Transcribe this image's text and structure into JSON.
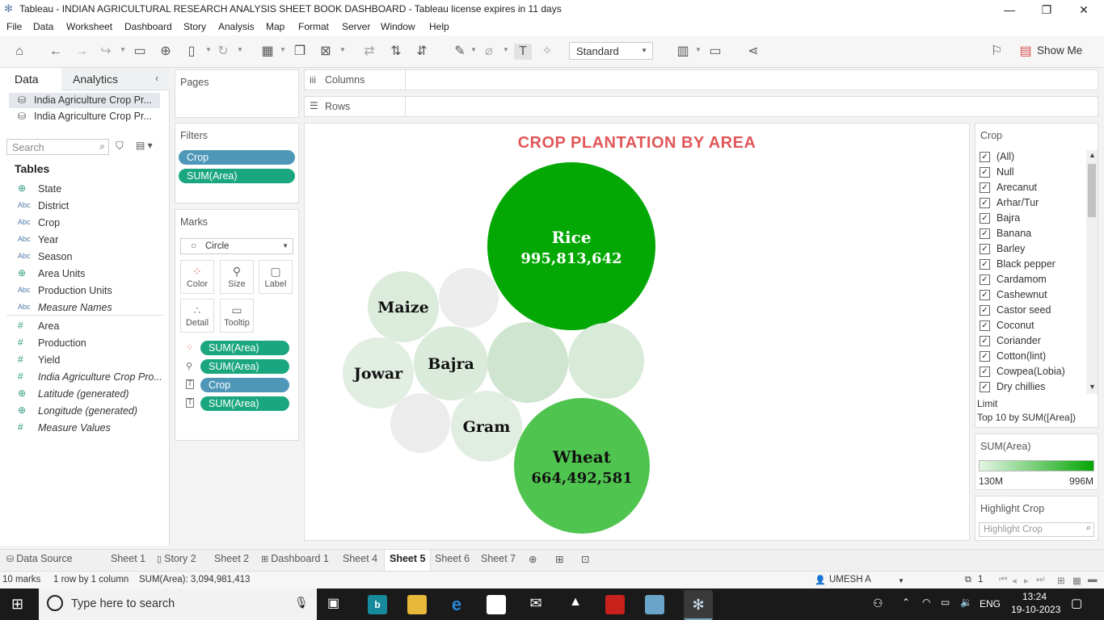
{
  "window": {
    "title": "Tableau - INDIAN AGRICULTURAL RESEARCH ANALYSIS SHEET BOOK DASHBOARD - Tableau license expires in 11 days"
  },
  "menu": [
    "File",
    "Data",
    "Worksheet",
    "Dashboard",
    "Story",
    "Analysis",
    "Map",
    "Format",
    "Server",
    "Window",
    "Help"
  ],
  "toolbar": {
    "fit_mode": "Standard",
    "show_me": "Show Me"
  },
  "left_pane": {
    "tab_data": "Data",
    "tab_analytics": "Analytics",
    "sources": [
      "India Agriculture Crop Pr...",
      "India Agriculture Crop Pr..."
    ],
    "search_placeholder": "Search",
    "tables_label": "Tables",
    "dimensions": [
      {
        "icon": "globe",
        "name": "State"
      },
      {
        "icon": "Abc",
        "name": "District"
      },
      {
        "icon": "Abc",
        "name": "Crop"
      },
      {
        "icon": "Abc",
        "name": "Year"
      },
      {
        "icon": "Abc",
        "name": "Season"
      },
      {
        "icon": "globe",
        "name": "Area Units"
      },
      {
        "icon": "Abc",
        "name": "Production Units"
      },
      {
        "icon": "Abc",
        "name": "Measure Names"
      }
    ],
    "measures": [
      {
        "icon": "#",
        "name": "Area"
      },
      {
        "icon": "#",
        "name": "Production"
      },
      {
        "icon": "#",
        "name": "Yield"
      },
      {
        "icon": "#",
        "name": "India Agriculture Crop Pro..."
      },
      {
        "icon": "globe",
        "name": "Latitude (generated)"
      },
      {
        "icon": "globe",
        "name": "Longitude (generated)"
      },
      {
        "icon": "#",
        "name": "Measure Values"
      }
    ]
  },
  "pages_label": "Pages",
  "filters": {
    "label": "Filters",
    "pills": [
      "Crop",
      "SUM(Area)"
    ]
  },
  "marks": {
    "label": "Marks",
    "type": "Circle",
    "buttons": [
      "Color",
      "Size",
      "Label",
      "Detail",
      "Tooltip"
    ],
    "pills": [
      "SUM(Area)",
      "SUM(Area)",
      "Crop",
      "SUM(Area)"
    ]
  },
  "shelves": {
    "columns": "Columns",
    "rows": "Rows"
  },
  "chart_data": {
    "type": "packed-bubble",
    "title": "CROP PLANTATION BY AREA",
    "measure": "SUM(Area)",
    "bubbles": [
      {
        "label": "Rice",
        "value": 995813642,
        "value_label": "995,813,642",
        "color": "#04a804"
      },
      {
        "label": "Wheat",
        "value": 664492581,
        "value_label": "664,492,581",
        "color": "#4fc44f"
      },
      {
        "label": "Maize",
        "value": null,
        "color": "#dcecdc"
      },
      {
        "label": "Jowar",
        "value": null,
        "color": "#e2eee2"
      },
      {
        "label": "Bajra",
        "value": null,
        "color": "#dbebdb"
      },
      {
        "label": "Gram",
        "value": null,
        "color": "#e2ede2"
      },
      {
        "label": "",
        "value": null,
        "color": "#cfe5cf"
      },
      {
        "label": "",
        "value": null,
        "color": "#d8ead8"
      },
      {
        "label": "",
        "value": null,
        "color": "#ededed"
      },
      {
        "label": "",
        "value": null,
        "color": "#ececec"
      }
    ]
  },
  "crop_filter": {
    "label": "Crop",
    "items": [
      "(All)",
      "Null",
      "Arecanut",
      "Arhar/Tur",
      "Bajra",
      "Banana",
      "Barley",
      "Black pepper",
      "Cardamom",
      "Cashewnut",
      "Castor seed",
      "Coconut",
      "Coriander",
      "Cotton(lint)",
      "Cowpea(Lobia)",
      "Dry chillies"
    ],
    "limit_label": "Limit",
    "limit_value": "Top 10 by SUM([Area])"
  },
  "legend": {
    "label": "SUM(Area)",
    "min": "130M",
    "max": "996M",
    "color_low": "#e5f5e5",
    "color_high": "#05a505"
  },
  "highlight": {
    "label": "Highlight Crop",
    "placeholder": "Highlight Crop"
  },
  "sheet_tabs": [
    "Data Source",
    "Sheet 1",
    "Story 2",
    "Sheet 2",
    "Dashboard 1",
    "Sheet 4",
    "Sheet 5",
    "Sheet 6",
    "Sheet 7"
  ],
  "status": {
    "marks": "10 marks",
    "dims": "1 row by 1 column",
    "sum": "SUM(Area): 3,094,981,413",
    "user": "UMESH A",
    "count": "1"
  },
  "taskbar": {
    "search_placeholder": "Type here to search",
    "lang": "ENG",
    "time": "13:24",
    "date": "19-10-2023"
  }
}
